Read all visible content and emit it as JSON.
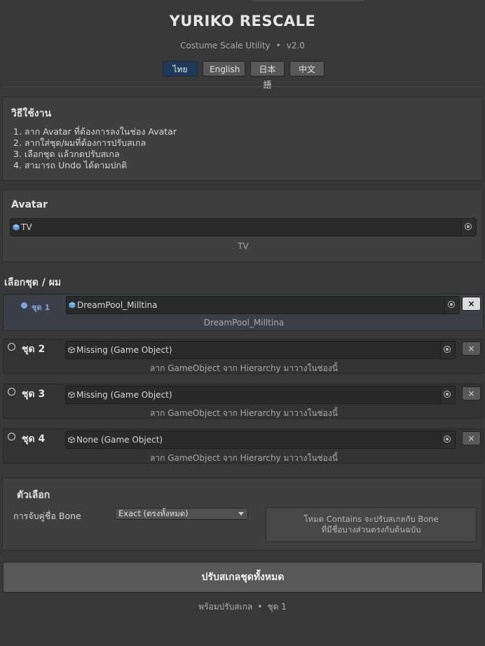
{
  "header": {
    "title": "YURIKO RESCALE",
    "subtitle": "Costume Scale Utility",
    "separator": "•",
    "version": "v2.0"
  },
  "languages": [
    {
      "label": "ไทย",
      "active": true
    },
    {
      "label": "English",
      "active": false
    },
    {
      "label": "日本語",
      "active": false
    },
    {
      "label": "中文",
      "active": false
    }
  ],
  "help": {
    "title": "วิธีใช้งาน",
    "steps": [
      "1. ลาก Avatar ที่ต้องการลงในช่อง Avatar",
      "2. ลากใส่ชุด/ผมที่ต้องการปรับสเกล",
      "3. เลือกชุด แล้วกดปรับสเกล",
      "4. สามารถ Undo ได้ตามปกติ"
    ]
  },
  "avatar": {
    "title": "Avatar",
    "value": "TV",
    "caption": "TV"
  },
  "outfits": {
    "title": "เลือกชุด / ผม",
    "slots": [
      {
        "label": "ชุด 1",
        "value": "DreamPool_Milltina",
        "caption": "DreamPool_Milltina",
        "active": true,
        "remove": "×"
      },
      {
        "label": "ชุด 2",
        "value": "Missing (Game Object)",
        "caption": "ลาก GameObject จาก Hierarchy มาวางในช่องนี้",
        "active": false,
        "remove": "×"
      },
      {
        "label": "ชุด 3",
        "value": "Missing (Game Object)",
        "caption": "ลาก GameObject จาก Hierarchy มาวางในช่องนี้",
        "active": false,
        "remove": "×"
      },
      {
        "label": "ชุด 4",
        "value": "None (Game Object)",
        "caption": "ลาก GameObject จาก Hierarchy มาวางในช่องนี้",
        "active": false,
        "remove": "×"
      }
    ]
  },
  "options": {
    "title": "ตัวเลือก",
    "bone_match_label": "การจับคู่ชื่อ Bone",
    "bone_match_value": "Exact (ตรงทั้งหมด)",
    "info_line1": "โหมด Contains จะปรับสเกลกับ Bone",
    "info_line2": "ที่มีชื่อบางส่วนตรงกับต้นฉบับ"
  },
  "action": {
    "rescale_all_label": "ปรับสเกลชุดทั้งหมด",
    "status_ready": "พร้อมปรับสเกล",
    "status_sep": "•",
    "status_selected": "ชุด 1"
  },
  "colors": {
    "accent": "#7aa7e0",
    "active_lang_bg": "#1e3a5a",
    "background": "#383838"
  },
  "icons": {
    "object": "cube-icon",
    "picker": "object-picker-icon",
    "remove": "close-icon"
  }
}
